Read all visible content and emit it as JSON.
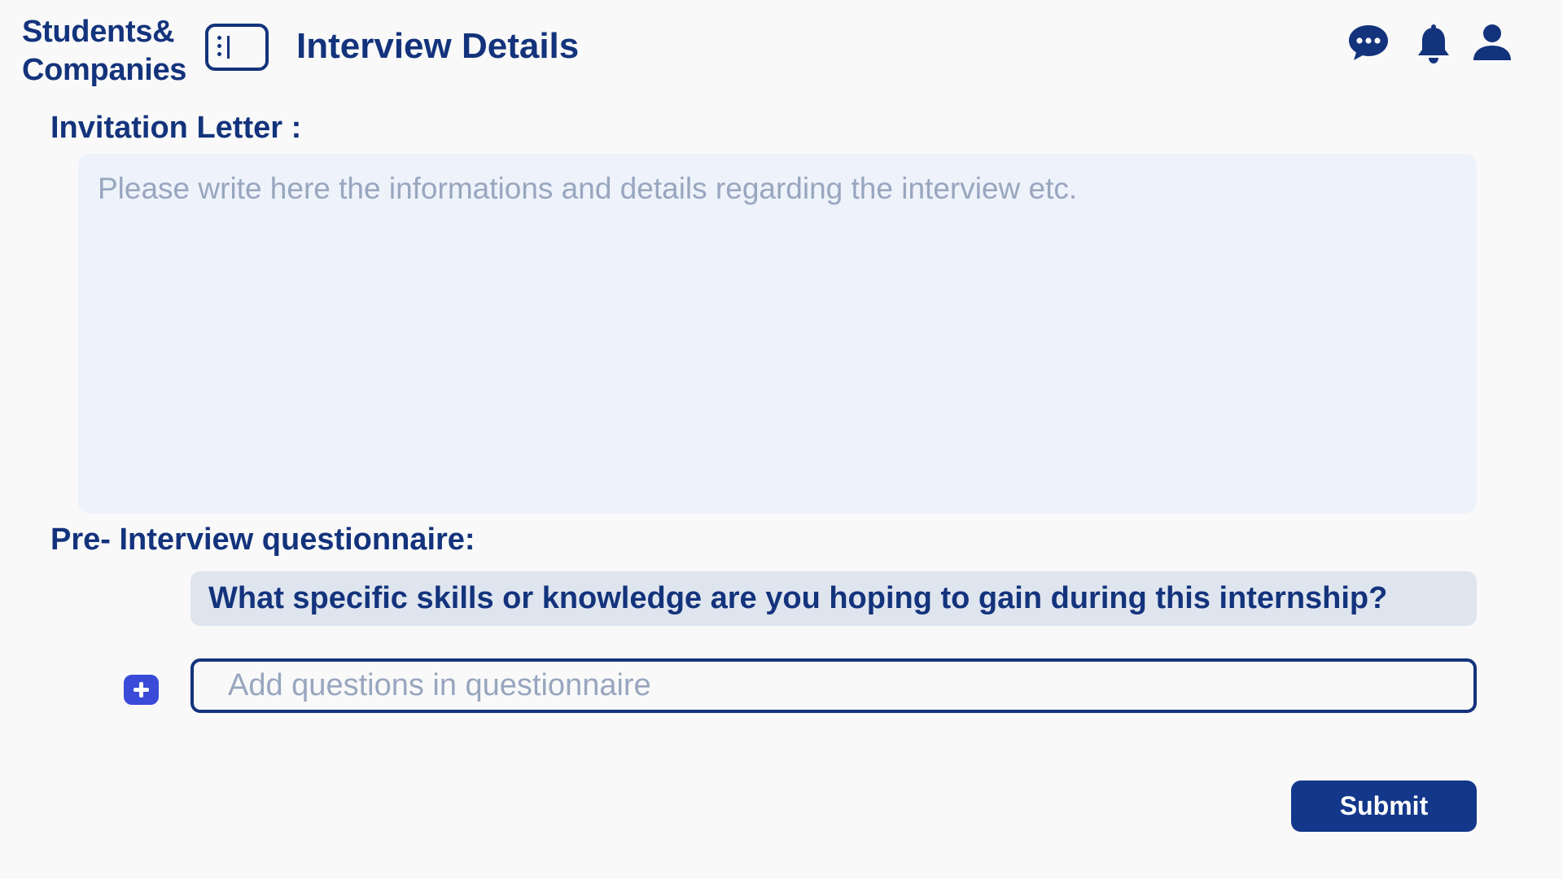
{
  "brand": {
    "line1": "Students&",
    "line2": "Companies"
  },
  "header": {
    "title": "Interview Details",
    "icons": [
      "sidebar-toggle-icon",
      "chat-icon",
      "bell-icon",
      "user-icon"
    ]
  },
  "invitation": {
    "label": "Invitation Letter :",
    "placeholder": "Please write here the informations and details regarding the interview etc."
  },
  "questionnaire": {
    "label": "Pre- Interview questionnaire:",
    "questions": [
      "What specific skills or knowledge are you hoping to gain during this internship?"
    ],
    "add_placeholder": "Add questions in questionnaire"
  },
  "actions": {
    "submit_label": "Submit"
  },
  "colors": {
    "primary": "#13337c",
    "accent": "#3a4bd8",
    "field_bg": "#eef2fa",
    "question_bg": "#dfe5ef",
    "placeholder": "#98a6bf",
    "page_bg": "#f9f9f9"
  }
}
